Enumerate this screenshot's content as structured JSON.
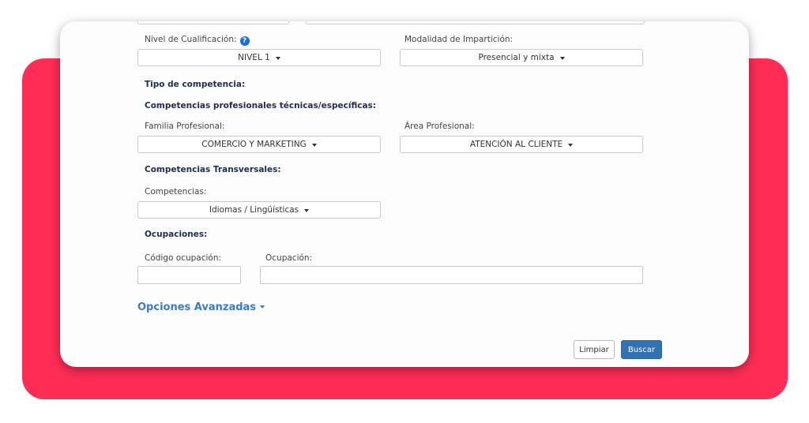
{
  "form": {
    "nivel_label": "Nivel de Cualificación:",
    "nivel_value": "NIVEL 1",
    "modalidad_label": "Modalidad de Impartición:",
    "modalidad_value": "Presencial y mixta",
    "tipo_competencia": "Tipo de competencia:",
    "comp_tecnicas": "Competencias profesionales técnicas/específicas:",
    "familia_label": "Familia Profesional:",
    "familia_value": "COMERCIO Y MARKETING",
    "area_label": "Área Profesional:",
    "area_value": "ATENCIÓN AL CLIENTE",
    "comp_transversales": "Competencias Transversales:",
    "competencias_label": "Competencias:",
    "competencias_value": "Idiomas / Lingüísticas",
    "ocupaciones_heading": "Ocupaciones:",
    "codigo_label": "Código ocupación:",
    "codigo_value": "",
    "ocupacion_label": "Ocupación:",
    "ocupacion_value": "",
    "advanced_label": "Opciones Avanzadas",
    "help_glyph": "?"
  },
  "actions": {
    "clear_label": "Limpiar",
    "search_label": "Buscar"
  },
  "colors": {
    "accent_red": "#ff2d55",
    "primary_button": "#3372b2",
    "link": "#3a7cc2",
    "heading": "#1f2d4d"
  },
  "icons": {
    "help": "question-circle-icon",
    "dropdown": "caret-down-icon"
  }
}
